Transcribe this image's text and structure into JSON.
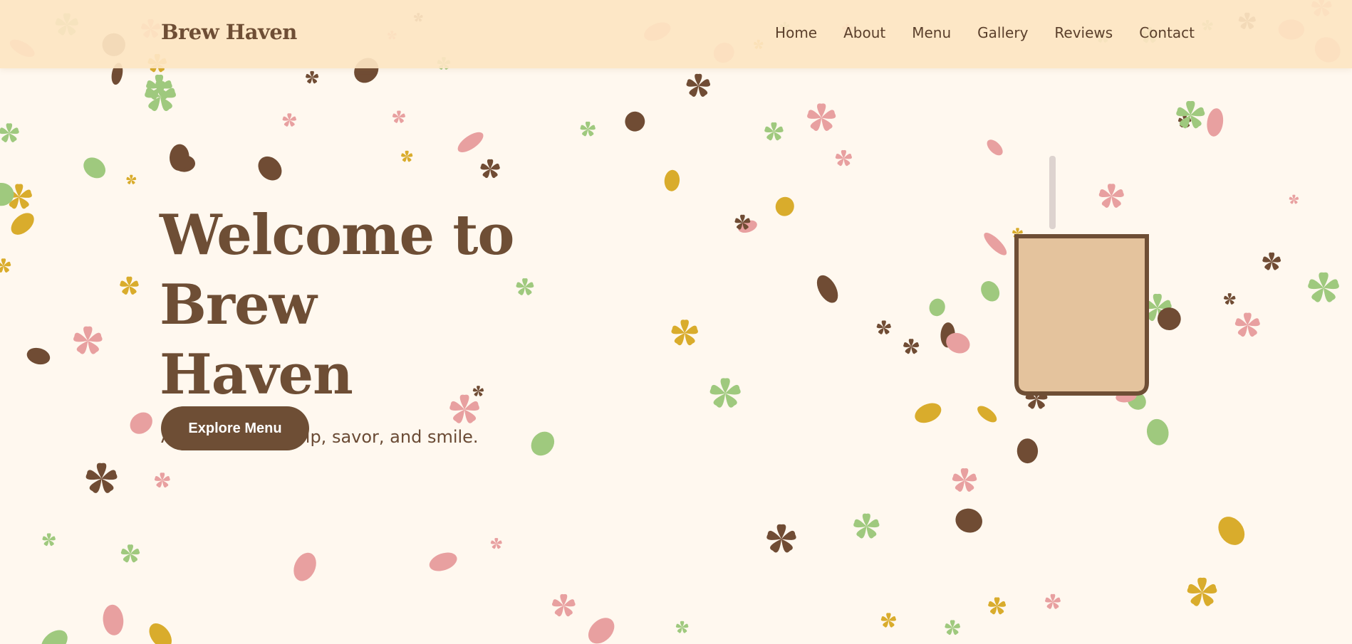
{
  "nav": {
    "brand": "Brew Haven",
    "items": [
      "Home",
      "About",
      "Menu",
      "Gallery",
      "Reviews",
      "Contact"
    ]
  },
  "hero": {
    "title_line1": "Welcome to Brew",
    "title_line2": "Haven",
    "subtitle": "A cozy place to sip, savor, and smile.",
    "cta_label": "Explore Menu"
  },
  "colors": {
    "background": "#fff8ef",
    "nav_background": "#fde5c3",
    "brown": "#6e4e35",
    "cup_fill": "#e4c39d",
    "confetti_gold": "#d9ac2c",
    "confetti_green": "#9fc97e",
    "confetti_pink": "#e8a0a0",
    "confetti_brown": "#704c34"
  }
}
